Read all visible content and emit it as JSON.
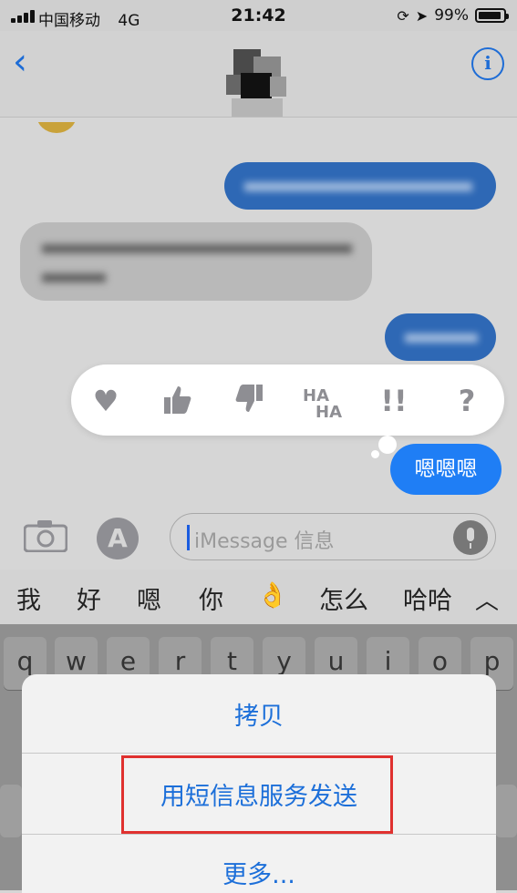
{
  "status_bar": {
    "carrier": "中国移动",
    "network": "4G",
    "time": "21:42",
    "battery": "99%"
  },
  "nav": {
    "back_icon": "chevron-left-icon",
    "info_icon": "info-icon",
    "info_glyph": "i"
  },
  "messages": {
    "selected_bubble_text": "嗯嗯嗯"
  },
  "tapback": {
    "icons": [
      "heart-icon",
      "thumbs-up-icon",
      "thumbs-down-icon",
      "haha-icon",
      "exclamation-icon",
      "question-icon"
    ]
  },
  "input": {
    "placeholder": "iMessage 信息"
  },
  "suggestions": [
    "我",
    "好",
    "嗯",
    "你",
    "👌",
    "怎么",
    "哈哈"
  ],
  "keyboard": {
    "row1": [
      "q",
      "w",
      "e",
      "r",
      "t",
      "y",
      "u",
      "i",
      "o",
      "p"
    ]
  },
  "action_sheet": {
    "copy": "拷贝",
    "send_as_sms": "用短信息服务发送",
    "more": "更多..."
  },
  "colors": {
    "accent": "#1c6fd9",
    "bubble_selected": "#1f7ef5",
    "highlight_box": "#e0312f"
  }
}
